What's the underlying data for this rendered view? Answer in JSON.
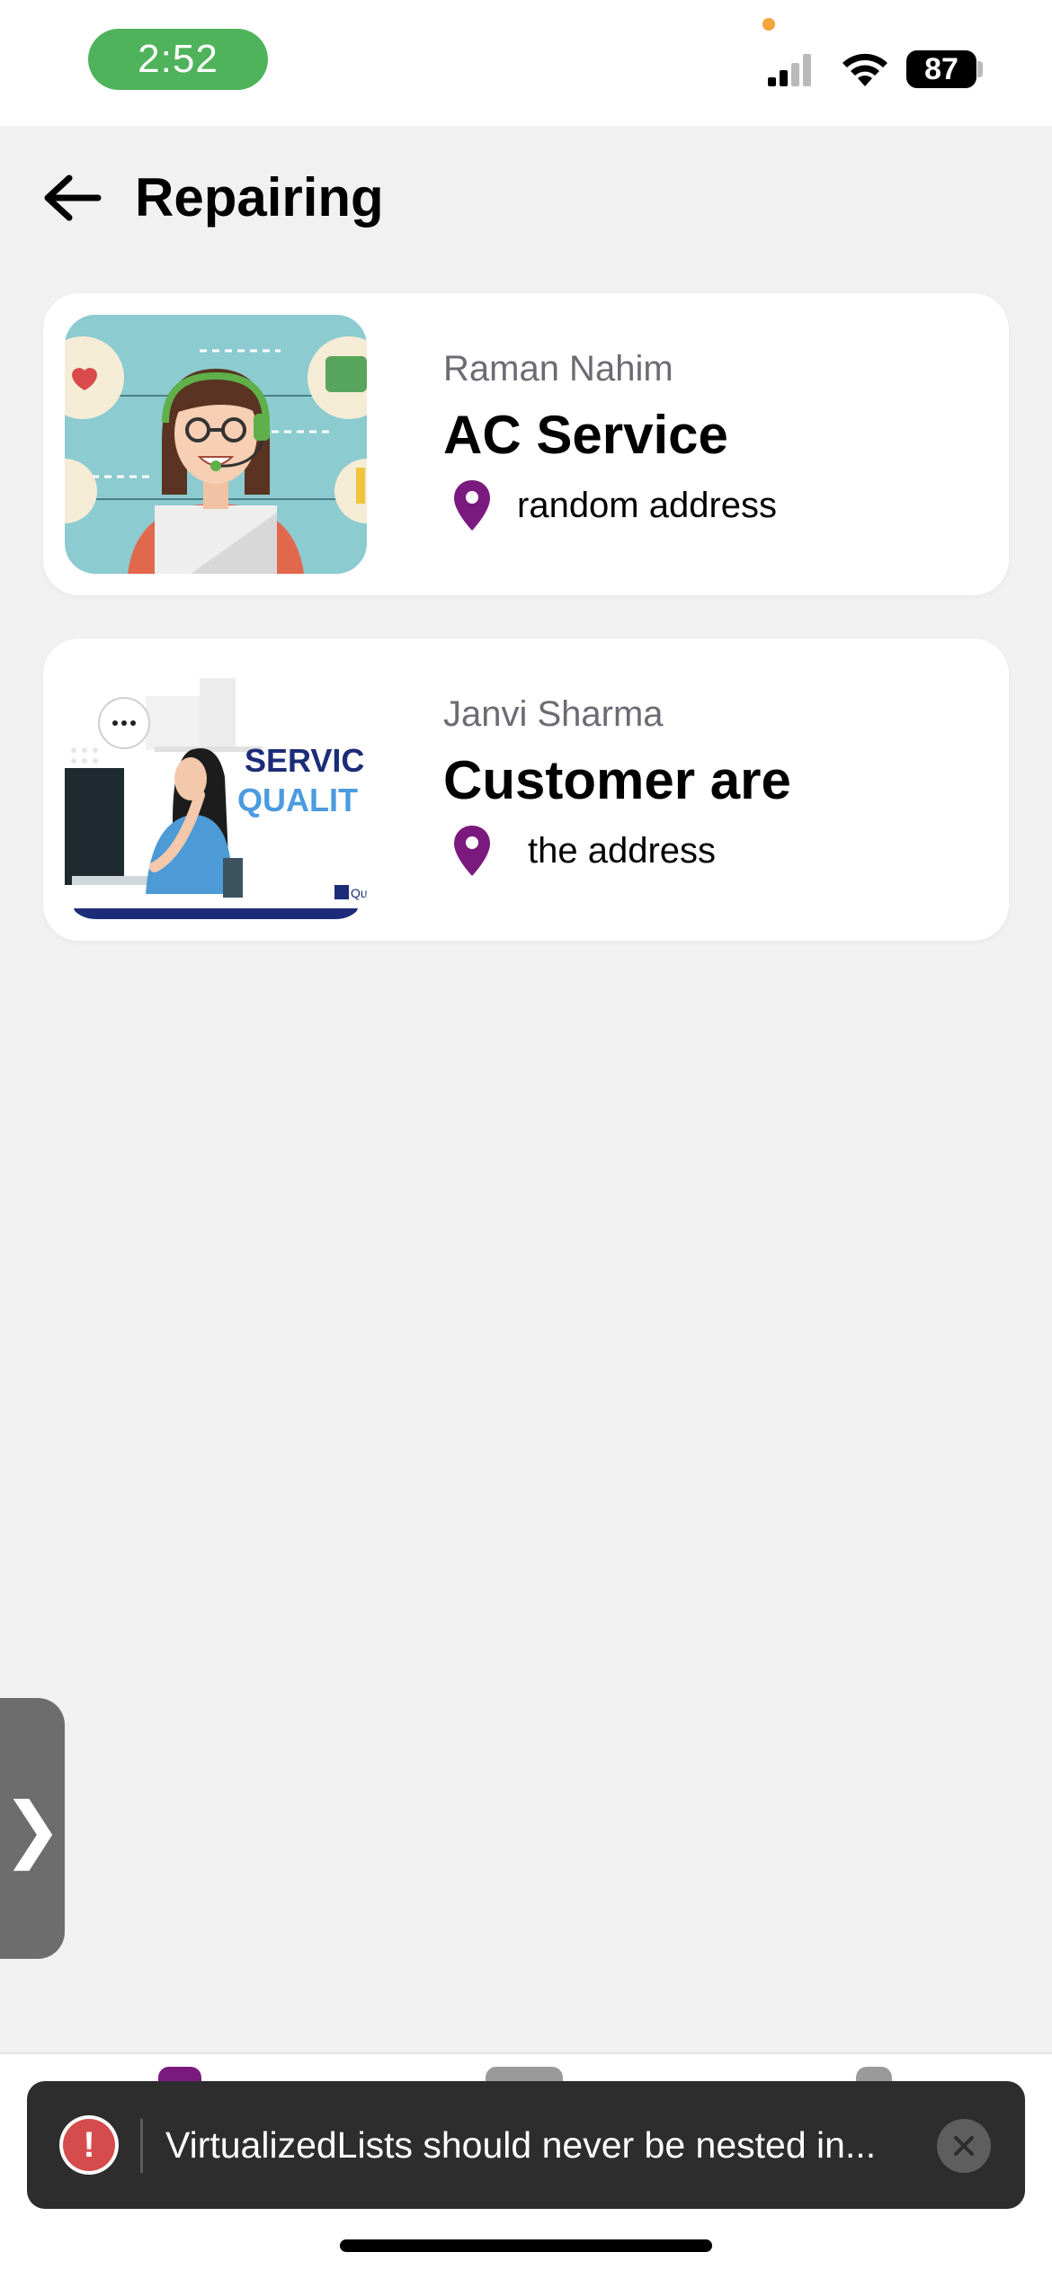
{
  "status_bar": {
    "time": "2:52",
    "battery": "87"
  },
  "header": {
    "title": "Repairing"
  },
  "services": [
    {
      "provider": "Raman Nahim",
      "title": "AC Service",
      "address": "random address",
      "image": "support-agent-illustration"
    },
    {
      "provider": "Janvi Sharma",
      "title": "Customer are",
      "address": "the address",
      "image": "service-quality-illustration",
      "image_text": [
        "SERVIC",
        "QUALIT",
        "Ques"
      ]
    }
  ],
  "side_tab": {
    "glyph": "❯"
  },
  "toast": {
    "message": "VirtualizedLists should never be nested in...",
    "icon_glyph": "!"
  },
  "colors": {
    "accent": "#7b1a7e",
    "status_pill": "#4fb35b",
    "toast_bg": "#2d2d2d",
    "error_red": "#d54c4c"
  }
}
